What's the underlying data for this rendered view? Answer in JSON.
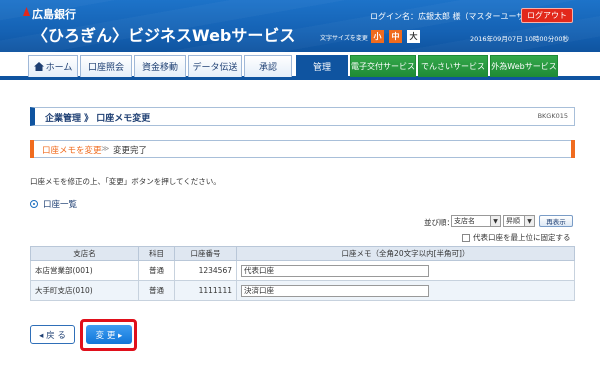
{
  "header": {
    "bank_name": "広島銀行",
    "service_name": "〈ひろぎん〉ビジネスWebサービス",
    "login_name": "ログイン名：広銀太郎 様（マスターユーザ）",
    "logout_label": "ログアウト",
    "font_size_label": "文字サイズを変更",
    "font_small": "小",
    "font_medium": "中",
    "font_large": "大",
    "datetime": "2016年09月07日 10時00分00秒"
  },
  "nav": {
    "tabs": [
      {
        "label": "ホーム"
      },
      {
        "label": "口座照会"
      },
      {
        "label": "資金移動"
      },
      {
        "label": "データ伝送"
      },
      {
        "label": "承認"
      },
      {
        "label": "管理"
      },
      {
        "label": "電子交付サービス"
      },
      {
        "label": "でんさいサービス"
      },
      {
        "label": "外為Webサービス"
      }
    ],
    "active_tab": "管理"
  },
  "page": {
    "title": "企業管理 》 口座メモ変更",
    "screen_id": "BKGK015",
    "step_current": "口座メモを変更",
    "step_sep": "≫",
    "step_next": "変更完了",
    "instruction": "口座メモを修正の上、「変更」ボタンを押してください。",
    "section_title": "口座一覧"
  },
  "sort": {
    "label": "並び順：",
    "field_value": "支店名",
    "order_value": "昇順",
    "resort_label": "再表示",
    "fix_label": "代表口座を最上位に固定する"
  },
  "table": {
    "headers": [
      "支店名",
      "科目",
      "口座番号",
      "口座メモ（全角20文字以内[半角可]）"
    ],
    "rows": [
      {
        "branch": "本店営業部(001)",
        "subject": "普通",
        "account": "1234567",
        "memo": "代表口座"
      },
      {
        "branch": "大手町支店(010)",
        "subject": "普通",
        "account": "1111111",
        "memo": "決済口座"
      }
    ]
  },
  "buttons": {
    "back_label": "◂ 戻 る",
    "change_label": "変 更 ▸"
  },
  "colors": {
    "brand_blue": "#1562b4",
    "accent_orange": "#f06b1e",
    "logout_red": "#e2281b",
    "highlight_red": "#e0101b",
    "green_tab": "#1f8a36"
  }
}
